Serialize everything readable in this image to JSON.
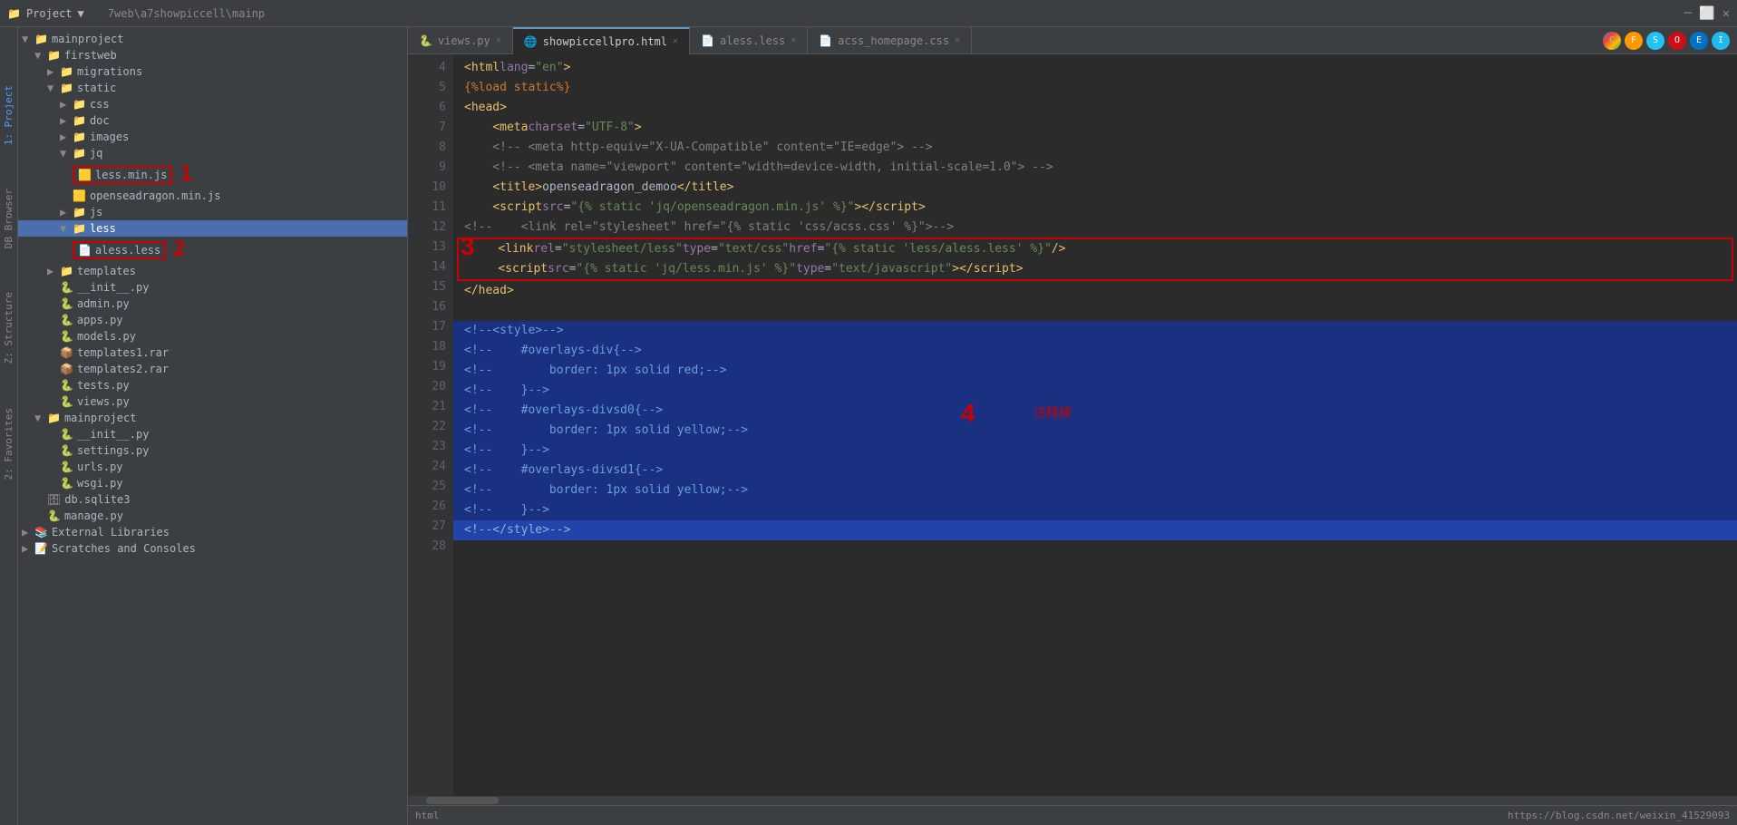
{
  "titleBar": {
    "projectLabel": "Project",
    "path": "7web\\a7showpiccell\\mainp"
  },
  "tabs": [
    {
      "id": "views-py",
      "label": "views.py",
      "active": false,
      "icon": "py"
    },
    {
      "id": "showpiccellpro-html",
      "label": "showpiccellpro.html",
      "active": true,
      "icon": "html"
    },
    {
      "id": "aless-less",
      "label": "aless.less",
      "active": false,
      "icon": "less"
    },
    {
      "id": "acss-homepage-css",
      "label": "acss_homepage.css",
      "active": false,
      "icon": "css"
    }
  ],
  "browserIcons": [
    "chrome",
    "firefox",
    "safari",
    "opera",
    "edge",
    "ie"
  ],
  "fileTree": {
    "items": [
      {
        "level": 0,
        "type": "folder",
        "label": "mainproject",
        "expanded": true
      },
      {
        "level": 1,
        "type": "folder",
        "label": "firstweb",
        "expanded": true
      },
      {
        "level": 2,
        "type": "folder",
        "label": "migrations",
        "expanded": false
      },
      {
        "level": 2,
        "type": "folder",
        "label": "static",
        "expanded": true
      },
      {
        "level": 3,
        "type": "folder",
        "label": "css",
        "expanded": false
      },
      {
        "level": 3,
        "type": "folder",
        "label": "doc",
        "expanded": false
      },
      {
        "level": 3,
        "type": "folder",
        "label": "images",
        "expanded": false
      },
      {
        "level": 3,
        "type": "folder",
        "label": "jq",
        "expanded": true
      },
      {
        "level": 4,
        "type": "file-js",
        "label": "less.min.js",
        "highlighted": true,
        "annotation": "1"
      },
      {
        "level": 4,
        "type": "file-js",
        "label": "openseadragon.min.js"
      },
      {
        "level": 3,
        "type": "folder",
        "label": "js",
        "expanded": false
      },
      {
        "level": 3,
        "type": "folder",
        "label": "less",
        "expanded": true,
        "selected": true
      },
      {
        "level": 4,
        "type": "file-less",
        "label": "aless.less",
        "highlighted": true,
        "annotation": "2"
      },
      {
        "level": 2,
        "type": "folder",
        "label": "templates",
        "expanded": false
      },
      {
        "level": 2,
        "type": "file-py",
        "label": "__init__.py"
      },
      {
        "level": 2,
        "type": "file-py",
        "label": "admin.py"
      },
      {
        "level": 2,
        "type": "file-py",
        "label": "apps.py"
      },
      {
        "level": 2,
        "type": "file-py",
        "label": "models.py"
      },
      {
        "level": 2,
        "type": "file-rar",
        "label": "templates1.rar"
      },
      {
        "level": 2,
        "type": "file-rar",
        "label": "templates2.rar"
      },
      {
        "level": 2,
        "type": "file-py",
        "label": "tests.py"
      },
      {
        "level": 2,
        "type": "file-py",
        "label": "views.py"
      },
      {
        "level": 1,
        "type": "folder",
        "label": "mainproject",
        "expanded": true
      },
      {
        "level": 2,
        "type": "file-py",
        "label": "__init__.py"
      },
      {
        "level": 2,
        "type": "file-py",
        "label": "settings.py"
      },
      {
        "level": 2,
        "type": "file-py",
        "label": "urls.py"
      },
      {
        "level": 2,
        "type": "file-py",
        "label": "wsgi.py"
      },
      {
        "level": 1,
        "type": "file-db",
        "label": "db.sqlite3"
      },
      {
        "level": 1,
        "type": "file-py",
        "label": "manage.py"
      },
      {
        "level": 0,
        "type": "folder",
        "label": "External Libraries",
        "expanded": false
      },
      {
        "level": 0,
        "type": "special",
        "label": "Scratches and Consoles"
      }
    ]
  },
  "codeLines": [
    {
      "num": 4,
      "content": "<html lang=\"en\">",
      "type": "normal"
    },
    {
      "num": 5,
      "content": "{% load static %}",
      "type": "normal"
    },
    {
      "num": 6,
      "content": "<head>",
      "type": "normal"
    },
    {
      "num": 7,
      "content": "    <meta charset=\"UTF-8\">",
      "type": "normal"
    },
    {
      "num": 8,
      "content": "    <!-- <meta http-equiv=\"X-UA-Compatible\" content=\"IE=edge\"> -->",
      "type": "normal"
    },
    {
      "num": 9,
      "content": "    <!-- <meta name=\"viewport\" content=\"width=device-width, initial-scale=1.0\"> -->",
      "type": "normal"
    },
    {
      "num": 10,
      "content": "    <title>openseadragon_demoo</title>",
      "type": "normal"
    },
    {
      "num": 11,
      "content": "    <script src=\"{% static 'jq/openseadragon.min.js' %}\"><\\/script>",
      "type": "normal"
    },
    {
      "num": 12,
      "content": "<!--     <link rel=\"stylesheet\" href=\"{% static 'css/acss.css' %}\">-->",
      "type": "normal"
    },
    {
      "num": 13,
      "content": "    <link rel=\"stylesheet/less\" type=\"text/css\" href=\"{% static 'less/aless.less' %}\" />",
      "type": "boxed"
    },
    {
      "num": 14,
      "content": "    <script src=\"{% static 'jq/less.min.js' %}\" type=\"text/javascript\"><\\/script>",
      "type": "boxed"
    },
    {
      "num": 15,
      "content": "</head>",
      "type": "normal"
    },
    {
      "num": 16,
      "content": "",
      "type": "normal"
    },
    {
      "num": 17,
      "content": "<!--<style>-->",
      "type": "blue-highlight"
    },
    {
      "num": 18,
      "content": "<!--    #overlays-div{-->",
      "type": "blue-highlight"
    },
    {
      "num": 19,
      "content": "<!--        border: 1px solid red;-->",
      "type": "blue-highlight"
    },
    {
      "num": 20,
      "content": "<!--    }-->",
      "type": "blue-highlight"
    },
    {
      "num": 21,
      "content": "<!--    #overlays-divsd0{-->",
      "type": "blue-highlight"
    },
    {
      "num": 22,
      "content": "<!--        border: 1px solid yellow;-->",
      "type": "blue-highlight"
    },
    {
      "num": 23,
      "content": "<!--    }-->",
      "type": "blue-highlight"
    },
    {
      "num": 24,
      "content": "<!--    #overlays-divsd1{-->",
      "type": "blue-highlight"
    },
    {
      "num": 25,
      "content": "<!--        border: 1px solid yellow;-->",
      "type": "blue-highlight"
    },
    {
      "num": 26,
      "content": "<!--    }-->",
      "type": "blue-highlight"
    },
    {
      "num": 27,
      "content": "<!--</style>-->",
      "type": "blue-bottom"
    },
    {
      "num": 28,
      "content": "",
      "type": "normal"
    }
  ],
  "annotations": {
    "num1": "1",
    "num2": "2",
    "num3": "3",
    "num4": "4",
    "chineseLabel": "注释掉"
  },
  "statusBar": {
    "language": "html",
    "url": "https://blog.csdn.net/weixin_41529093"
  },
  "verticalTabs": [
    {
      "id": "project",
      "label": "1: Project"
    },
    {
      "id": "db-browser",
      "label": "DB Browser"
    },
    {
      "id": "z-structure",
      "label": "Z: Structure"
    },
    {
      "id": "favorites",
      "label": "2: Favorites"
    }
  ]
}
